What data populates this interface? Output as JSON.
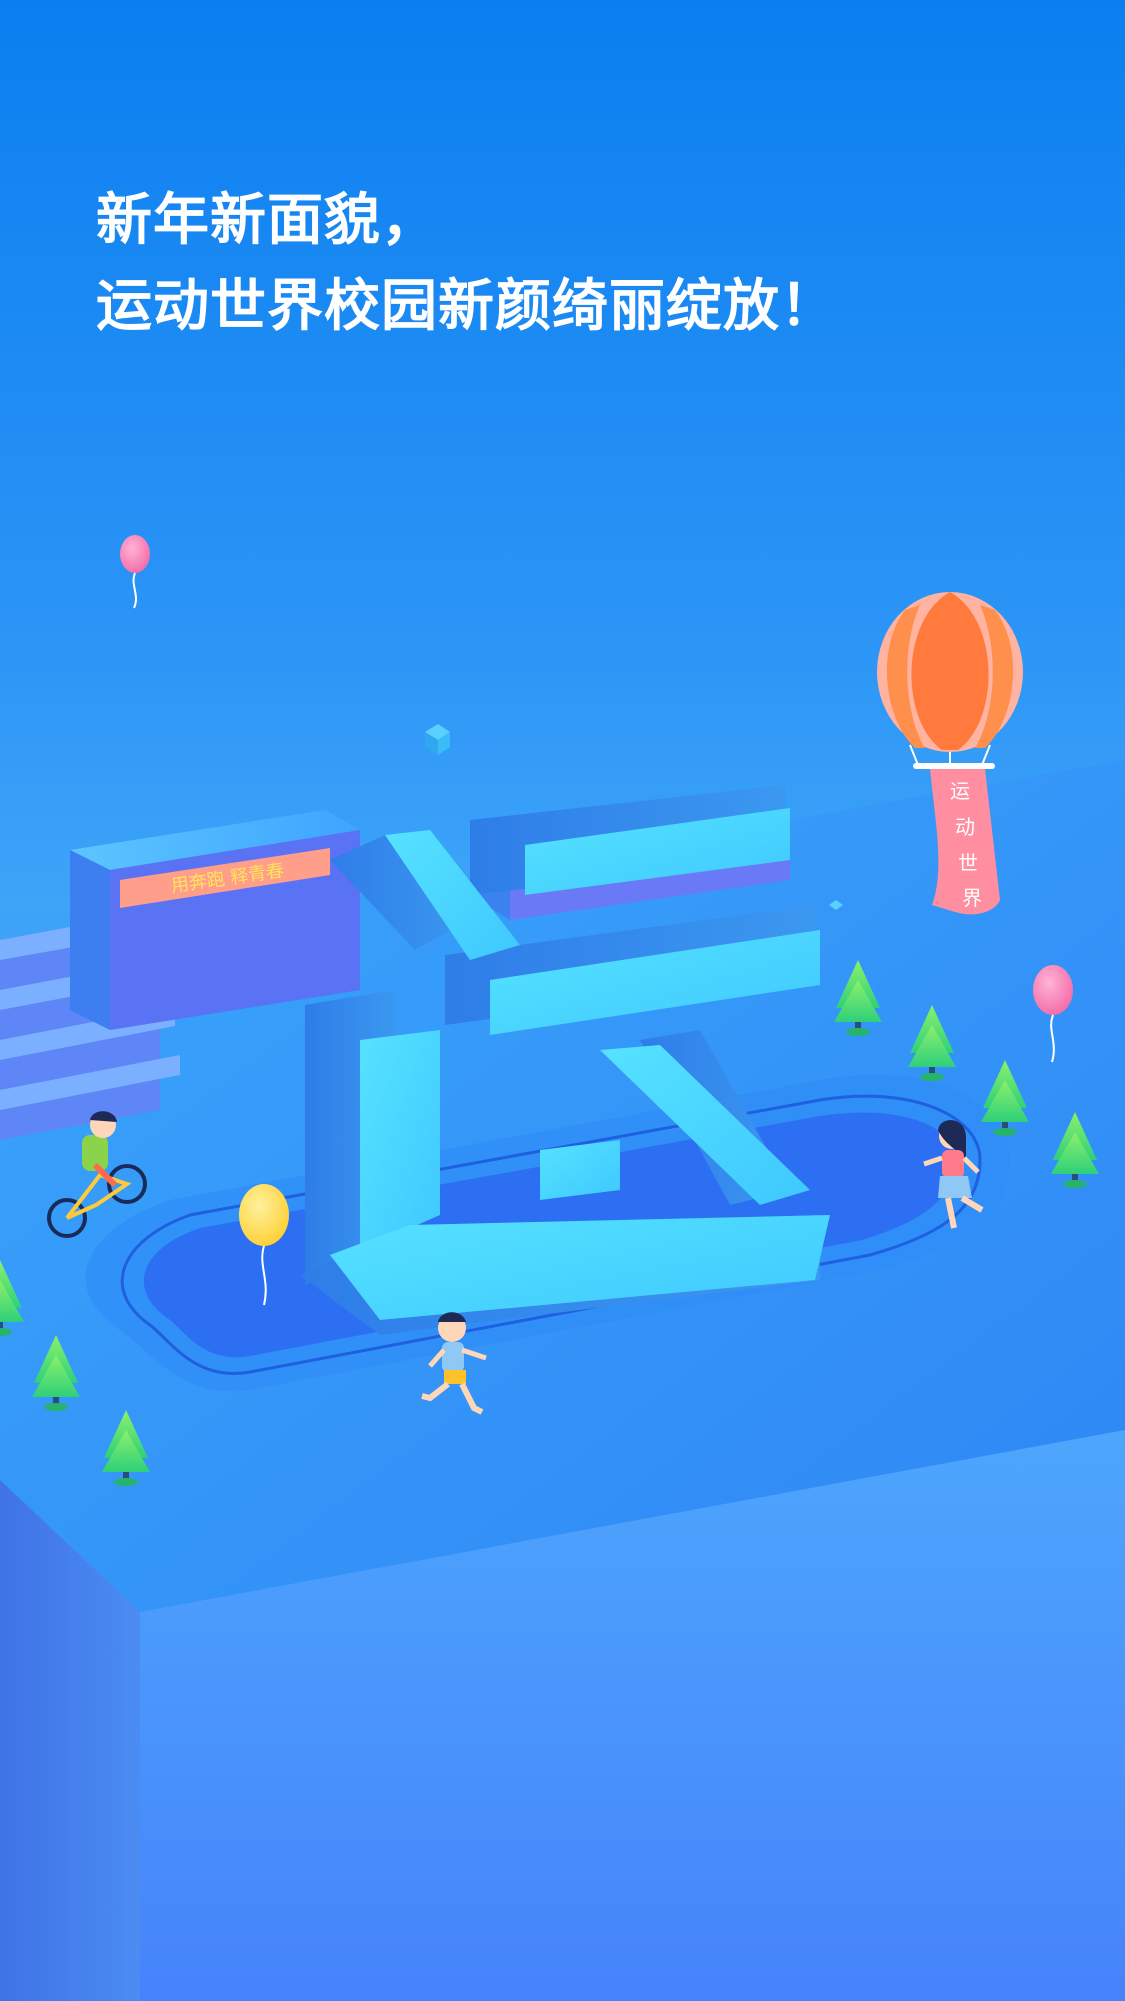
{
  "headline": {
    "line1": "新年新面貌，",
    "line2": "运动世界校园新颜绮丽绽放！"
  },
  "scene": {
    "banner_text": "用奔跑  释青春",
    "big_character": "运",
    "balloon_flag": [
      "运",
      "动",
      "世",
      "界"
    ]
  },
  "colors": {
    "sky_top": "#0b7ff0",
    "platform": "#3e9cf8",
    "track": "#2a6ff0",
    "character": "#42d6ff",
    "balloon_orange": "#ff7a3c",
    "balloon_pink": "#f57eb6",
    "balloon_yellow": "#ffd84a",
    "tree": "#5ee86a"
  }
}
